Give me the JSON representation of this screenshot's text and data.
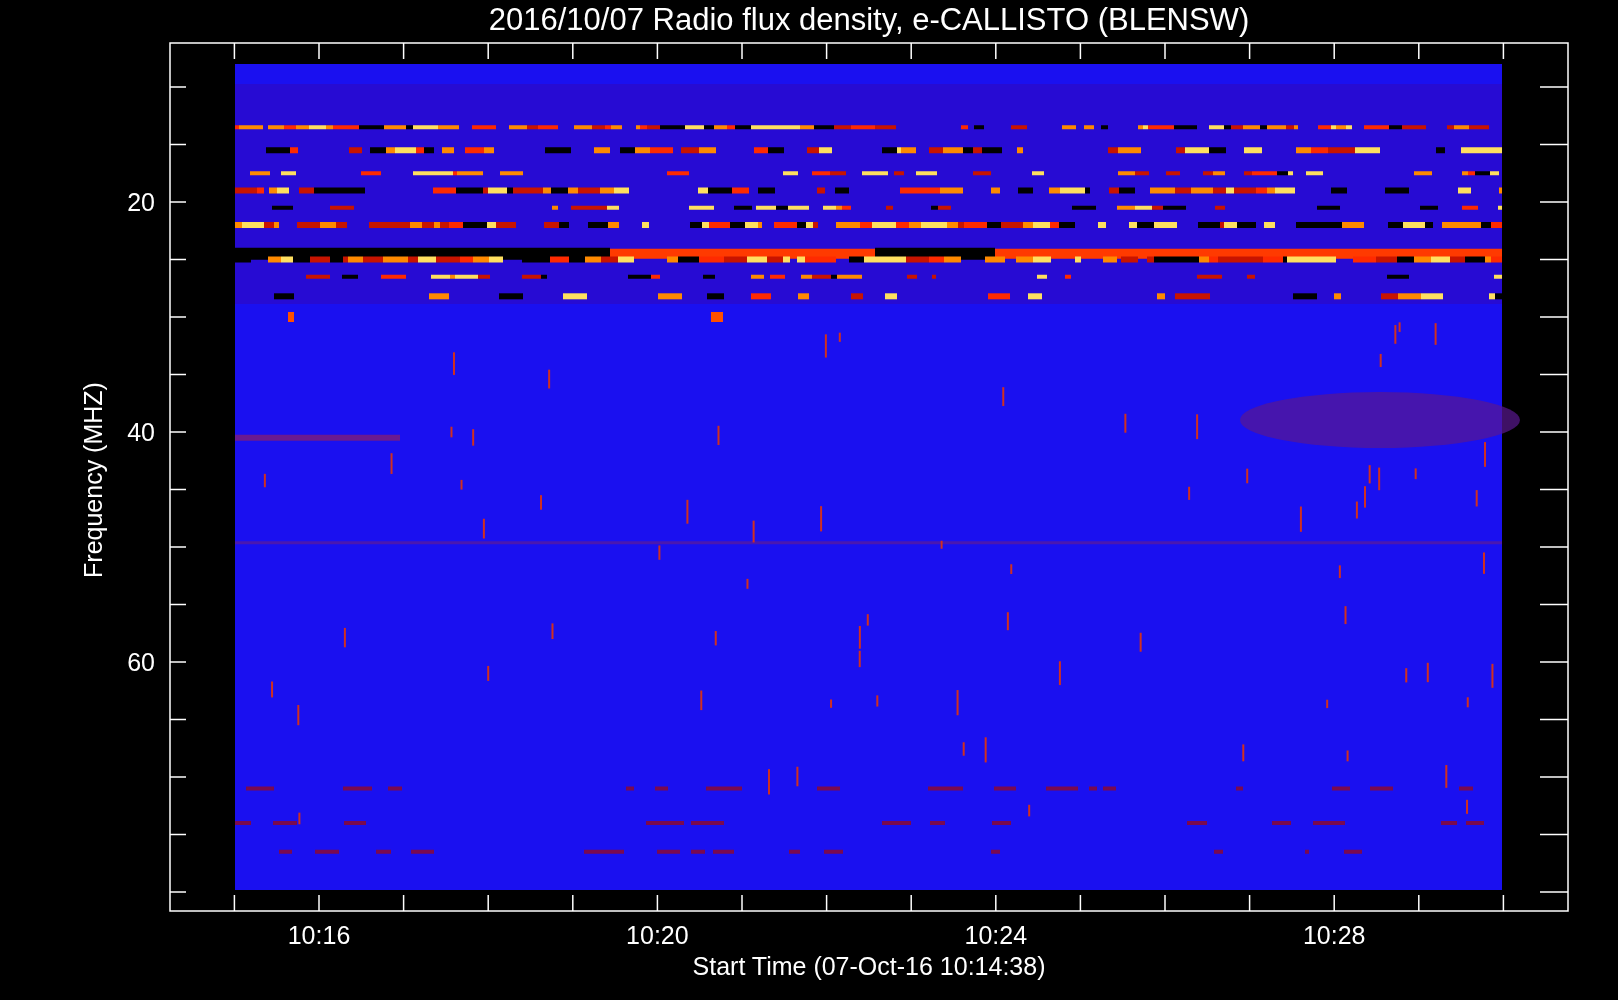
{
  "title": "2016/10/07  Radio flux density, e-CALLISTO (BLENSW)",
  "y_axis": {
    "label": "Frequency (MHZ)",
    "ticks": [
      "20",
      "40",
      "60"
    ]
  },
  "x_axis": {
    "label": "Start Time (07-Oct-16 10:14:38)",
    "ticks": [
      "10:16",
      "10:20",
      "10:24",
      "10:28"
    ]
  }
}
